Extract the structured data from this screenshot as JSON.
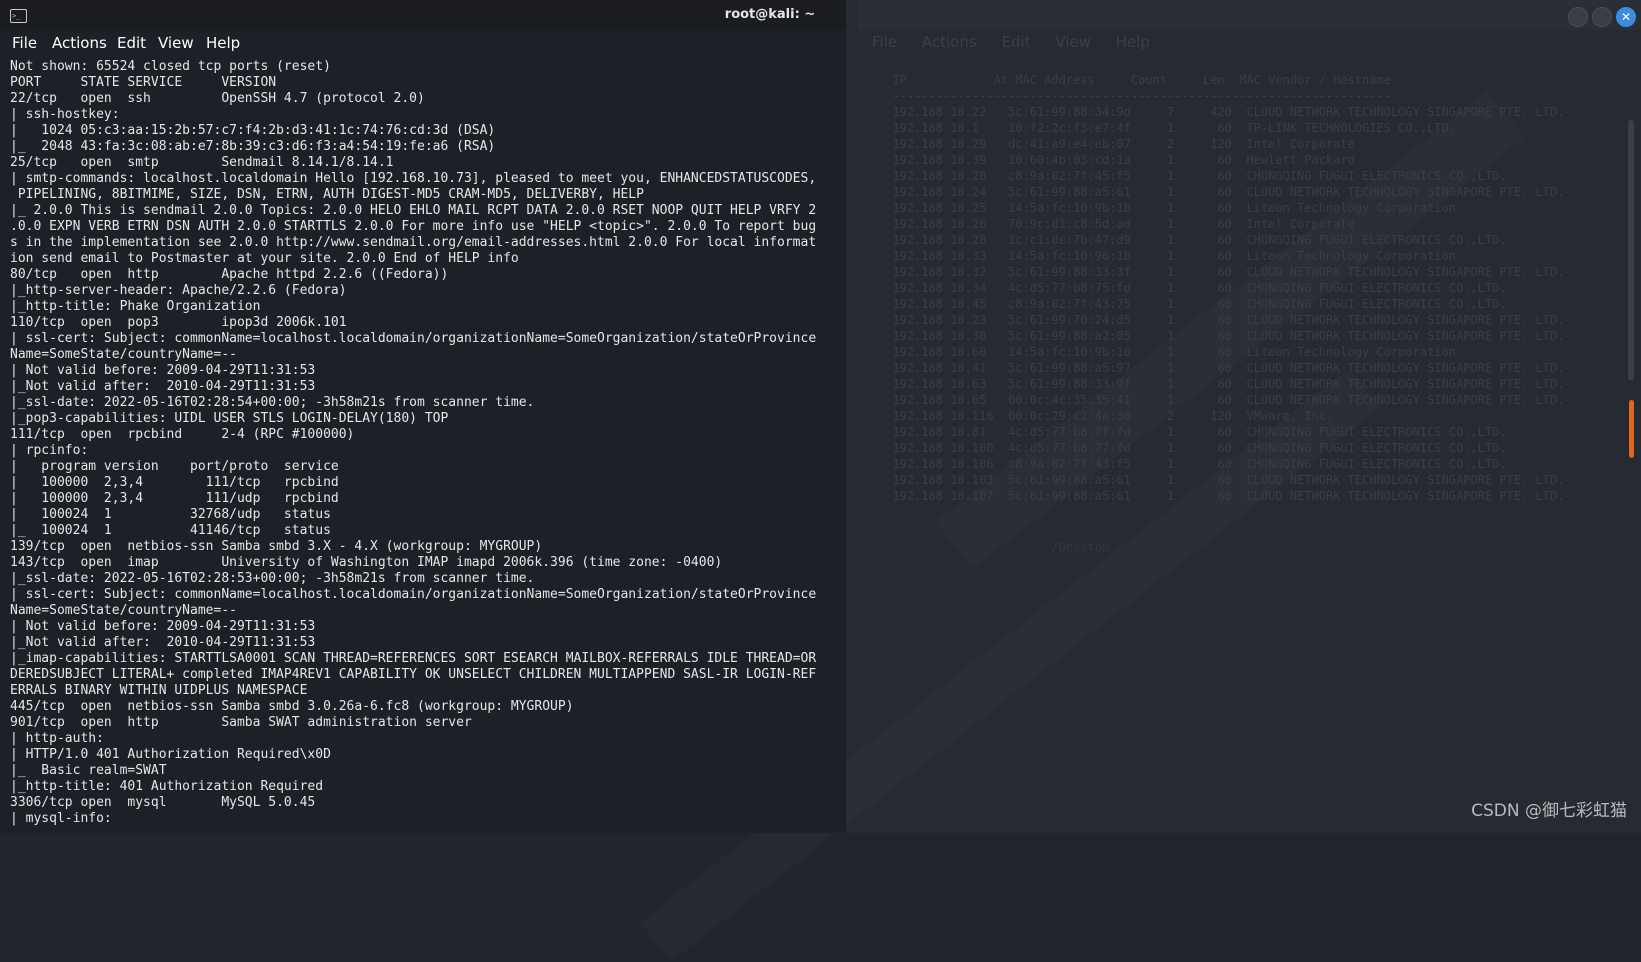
{
  "window": {
    "title": "root@kali: ~",
    "menu": [
      "File",
      "Actions",
      "Edit",
      "View",
      "Help"
    ],
    "close_glyph": "✕"
  },
  "terminal_lines": [
    "Not shown: 65524 closed tcp ports (reset)",
    "PORT     STATE SERVICE     VERSION",
    "22/tcp   open  ssh         OpenSSH 4.7 (protocol 2.0)",
    "| ssh-hostkey:",
    "|   1024 05:c3:aa:15:2b:57:c7:f4:2b:d3:41:1c:74:76:cd:3d (DSA)",
    "|_  2048 43:fa:3c:08:ab:e7:8b:39:c3:d6:f3:a4:54:19:fe:a6 (RSA)",
    "25/tcp   open  smtp        Sendmail 8.14.1/8.14.1",
    "| smtp-commands: localhost.localdomain Hello [192.168.10.73], pleased to meet you, ENHANCEDSTATUSCODES,",
    " PIPELINING, 8BITMIME, SIZE, DSN, ETRN, AUTH DIGEST-MD5 CRAM-MD5, DELIVERBY, HELP",
    "|_ 2.0.0 This is sendmail 2.0.0 Topics: 2.0.0 HELO EHLO MAIL RCPT DATA 2.0.0 RSET NOOP QUIT HELP VRFY 2",
    ".0.0 EXPN VERB ETRN DSN AUTH 2.0.0 STARTTLS 2.0.0 For more info use \"HELP <topic>\". 2.0.0 To report bug",
    "s in the implementation see 2.0.0 http://www.sendmail.org/email-addresses.html 2.0.0 For local informat",
    "ion send email to Postmaster at your site. 2.0.0 End of HELP info",
    "80/tcp   open  http        Apache httpd 2.2.6 ((Fedora))",
    "|_http-server-header: Apache/2.2.6 (Fedora)",
    "|_http-title: Phake Organization",
    "110/tcp  open  pop3        ipop3d 2006k.101",
    "| ssl-cert: Subject: commonName=localhost.localdomain/organizationName=SomeOrganization/stateOrProvince",
    "Name=SomeState/countryName=--",
    "| Not valid before: 2009-04-29T11:31:53",
    "|_Not valid after:  2010-04-29T11:31:53",
    "|_ssl-date: 2022-05-16T02:28:54+00:00; -3h58m21s from scanner time.",
    "|_pop3-capabilities: UIDL USER STLS LOGIN-DELAY(180) TOP",
    "111/tcp  open  rpcbind     2-4 (RPC #100000)",
    "| rpcinfo:",
    "|   program version    port/proto  service",
    "|   100000  2,3,4        111/tcp   rpcbind",
    "|   100000  2,3,4        111/udp   rpcbind",
    "|   100024  1          32768/udp   status",
    "|_  100024  1          41146/tcp   status",
    "139/tcp  open  netbios-ssn Samba smbd 3.X - 4.X (workgroup: MYGROUP)",
    "143/tcp  open  imap        University of Washington IMAP imapd 2006k.396 (time zone: -0400)",
    "|_ssl-date: 2022-05-16T02:28:53+00:00; -3h58m21s from scanner time.",
    "| ssl-cert: Subject: commonName=localhost.localdomain/organizationName=SomeOrganization/stateOrProvince",
    "Name=SomeState/countryName=--",
    "| Not valid before: 2009-04-29T11:31:53",
    "|_Not valid after:  2010-04-29T11:31:53",
    "|_imap-capabilities: STARTTLSA0001 SCAN THREAD=REFERENCES SORT ESEARCH MAILBOX-REFERRALS IDLE THREAD=OR",
    "DEREDSUBJECT LITERAL+ completed IMAP4REV1 CAPABILITY OK UNSELECT CHILDREN MULTIAPPEND SASL-IR LOGIN-REF",
    "ERRALS BINARY WITHIN UIDPLUS NAMESPACE",
    "445/tcp  open  netbios-ssn Samba smbd 3.0.26a-6.fc8 (workgroup: MYGROUP)",
    "901/tcp  open  http        Samba SWAT administration server",
    "| http-auth:",
    "| HTTP/1.0 401 Authorization Required\\x0D",
    "|_  Basic realm=SWAT",
    "|_http-title: 401 Authorization Required",
    "3306/tcp open  mysql       MySQL 5.0.45",
    "| mysql-info:"
  ],
  "background_window": {
    "menu": [
      "File",
      "Actions",
      "Edit",
      "View",
      "Help"
    ],
    "table_lines": [
      "  IP            At MAC Address     Count     Len  MAC Vendor / Hostname",
      "  ---------------------------------------------------------------------",
      "  192.168.10.22   5c:61:99:88:34:9d     7     420  CLOUD NETWORK TECHNOLOGY SINGAPORE PTE. LTD.",
      "  192.168.10.1    10:f2:2c:f3:e7:4f     1      60  TP-LINK TECHNOLOGIES CO.,LTD.",
      "  192.168.10.29   dc:41:a9:e4:eb:07     2     120  Intel Corporate",
      "  192.168.10.39   10:60:4b:03:cd:1a     1      60  Hewlett Packard",
      "  192.168.10.20   c8:9a:02:7f:45:f5     1      60  CHONGQING FUGUI ELECTRONICS CO.,LTD.",
      "  192.168.10.24   5c:61:99:88:a5:61     1      60  CLOUD NETWORK TECHNOLOGY SINGAPORE PTE. LTD.",
      "  192.168.10.25   14:5a:fc:10:9b:1b     1      60  Liteon Technology Corporation",
      "  192.168.10.26   70:9c:d1:c8:5d:ad     1      60  Intel Corporate",
      "  192.168.10.28   1c:c1:de:7b:47:d9     1      60  CHONGQING FUGUI ELECTRONICS CO.,LTD.",
      "  192.168.10.33   14:5a:fc:10:96:1b     1      60  Liteon Technology Corporation",
      "  192.168.10.32   5c:61:99:88:33:3f     1      60  CLOUD NETWORK TECHNOLOGY SINGAPORE PTE. LTD.",
      "  192.168.10.34   4c:d5:77:b8:75:fd     1      60  CHONGQING FUGUI ELECTRONICS CO.,LTD.",
      "  192.168.10.45   c8:9a:02:7f:43:75     1      60  CHONGQING FUGUI ELECTRONICS CO.,LTD.",
      "  192.168.10.23   5c:61:99:70:24:d5     1      60  CLOUD NETWORK TECHNOLOGY SINGAPORE PTE. LTD.",
      "  192.168.10.30   5c:61:99:88:a2:05     1      60  CLOUD NETWORK TECHNOLOGY SINGAPORE PTE. LTD.",
      "  192.168.10.60   14:5a:fc:10:9b:10     1      60  Liteon Technology Corporation",
      "  192.168.10.41   5c:61:99:88:a5:97     1      60  CLOUD NETWORK TECHNOLOGY SINGAPORE PTE. LTD.",
      "  192.168.10.63   5c:61:99:88:33:9f     1      60  CLOUD NETWORK TECHNOLOGY SINGAPORE PTE. LTD.",
      "  192.168.10.65   00:0c:4c:35:35:41     1      60  CLOUD NETWORK TECHNOLOGY SINGAPORE PTE. LTD.",
      "  192.168.10.116  00:0c:29:c2:4a:30     2     120  VMware, Inc.",
      "  192.168.10.81   4c:d5:77:b8:7f:fd     1      60  CHONGQING FUGUI ELECTRONICS CO.,LTD.",
      "  192.168.10.100  4c:d5:77:b8:77:fd     1      60  CHONGQING FUGUI ELECTRONICS CO.,LTD.",
      "  192.168.10.106  c8:9a:02:7f:43:f5     1      60  CHONGQING FUGUI ELECTRONICS CO.,LTD.",
      "  192.168.10.103  5c:61:99:88:a5:61     1      60  CLOUD NETWORK TECHNOLOGY SINGAPORE PTE. LTD.",
      "  192.168.10.107  5c:61:99:88:a5:61     1      60  CLOUD NETWORK TECHNOLOGY SINGAPORE PTE. LTD."
    ],
    "prompt": "                       ~/Desktop"
  },
  "watermark": "CSDN @御七彩虹猫"
}
